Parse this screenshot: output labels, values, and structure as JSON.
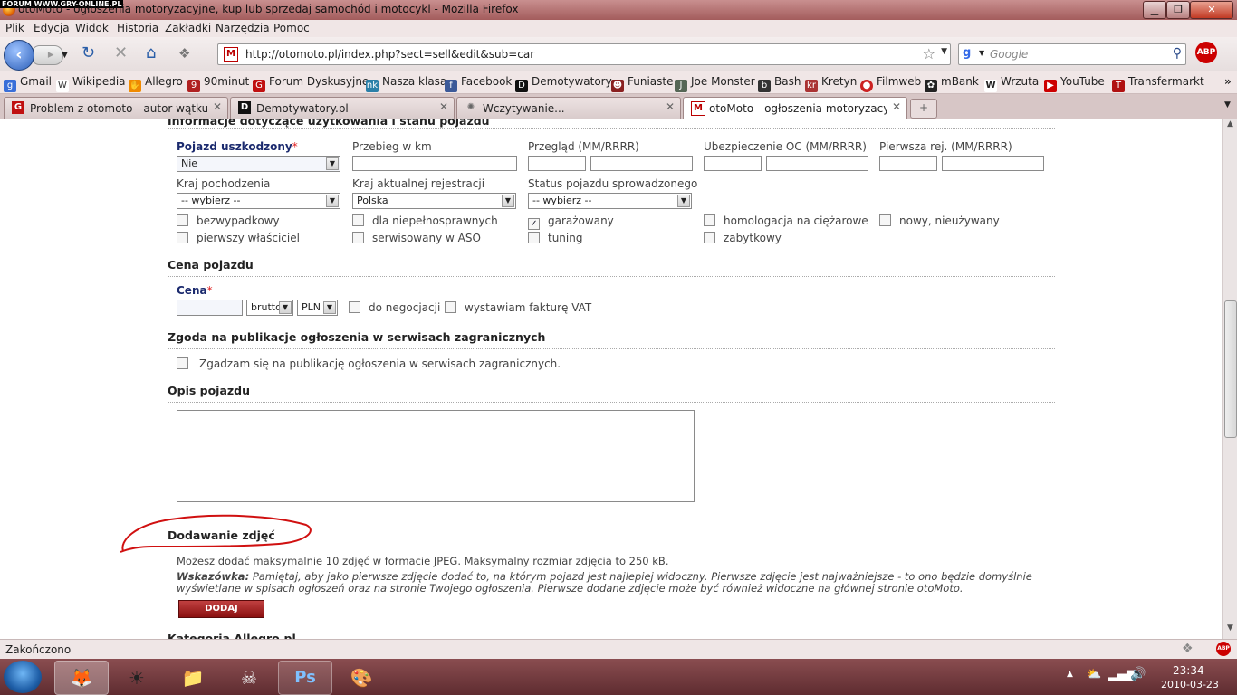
{
  "window": {
    "title": "otoMoto - ogłoszenia motoryzacyjne, kup lub sprzedaj samochód i motocykl - Mozilla Firefox",
    "watermark": "FORUM WWW.GRY-ONLINE.PL"
  },
  "menu": [
    "Plik",
    "Edycja",
    "Widok",
    "Historia",
    "Zakładki",
    "Narzędzia",
    "Pomoc"
  ],
  "nav": {
    "url": "http://otomoto.pl/index.php?sect=sell&edit&sub=car",
    "search_placeholder": "Google",
    "adblock_label": "ABP"
  },
  "bookmarks": [
    {
      "label": "Gmail",
      "icon": "gmail-icon",
      "color": "#3a6fd8"
    },
    {
      "label": "Wikipedia",
      "icon": "wikipedia-icon",
      "color": "#444444"
    },
    {
      "label": "Allegro",
      "icon": "allegro-icon",
      "color": "#f08a00"
    },
    {
      "label": "90minut",
      "icon": "90minut-icon",
      "color": "#b02020"
    },
    {
      "label": "Forum Dyskusyjne",
      "icon": "gry-online-icon",
      "color": "#c01010"
    },
    {
      "label": "Nasza klasa",
      "icon": "nasza-klasa-icon",
      "color": "#2a7fa8"
    },
    {
      "label": "Facebook",
      "icon": "facebook-icon",
      "color": "#3b5998"
    },
    {
      "label": "Demotywatory",
      "icon": "demotywatory-icon",
      "color": "#111111"
    },
    {
      "label": "Funiaste",
      "icon": "funiaste-icon",
      "color": "#8a2020"
    },
    {
      "label": "Joe Monster",
      "icon": "joe-monster-icon",
      "color": "#556655"
    },
    {
      "label": "Bash",
      "icon": "bash-icon",
      "color": "#333333"
    },
    {
      "label": "Kretyn",
      "icon": "kretyn-icon",
      "color": "#aa3333"
    },
    {
      "label": "Filmweb",
      "icon": "filmweb-icon",
      "color": "#cc2222"
    },
    {
      "label": "mBank",
      "icon": "mbank-icon",
      "color": "#222222"
    },
    {
      "label": "Wrzuta",
      "icon": "wrzuta-icon",
      "color": "#444444"
    },
    {
      "label": "YouTube",
      "icon": "youtube-icon",
      "color": "#cc0000"
    },
    {
      "label": "Transfermarkt",
      "icon": "transfermarkt-icon",
      "color": "#b01010"
    }
  ],
  "tabs": [
    {
      "label": "Problem z otomoto - autor wątku: ...",
      "icon": "G",
      "active": false
    },
    {
      "label": "Demotywatory.pl",
      "icon": "D",
      "active": false
    },
    {
      "label": "Wczytywanie...",
      "icon": "loading",
      "active": false
    },
    {
      "label": "otoMoto - ogłoszenia motoryzacy...",
      "icon": "M",
      "active": true
    }
  ],
  "form": {
    "section1_title": "Informacje dotyczące użytkowania i stanu pojazdu",
    "damaged": {
      "label": "Pojazd uszkodzony",
      "required_mark": "*",
      "value": "Nie"
    },
    "mileage_label": "Przebieg w km",
    "inspection_label": "Przegląd (MM/RRRR)",
    "insurance_label": "Ubezpieczenie OC (MM/RRRR)",
    "first_reg_label": "Pierwsza rej. (MM/RRRR)",
    "origin": {
      "label": "Kraj pochodzenia",
      "value": "-- wybierz --"
    },
    "current_reg": {
      "label": "Kraj aktualnej rejestracji",
      "value": "Polska"
    },
    "import_status": {
      "label": "Status pojazdu sprowadzonego",
      "value": "-- wybierz --"
    },
    "checkboxes": [
      {
        "label": "bezwypadkowy",
        "checked": false
      },
      {
        "label": "dla niepełnosprawnych",
        "checked": false
      },
      {
        "label": "garażowany",
        "checked": true
      },
      {
        "label": "homologacja na ciężarowe",
        "checked": false
      },
      {
        "label": "nowy, nieużywany",
        "checked": false
      },
      {
        "label": "pierwszy właściciel",
        "checked": false
      },
      {
        "label": "serwisowany w ASO",
        "checked": false
      },
      {
        "label": "tuning",
        "checked": false
      },
      {
        "label": "zabytkowy",
        "checked": false
      }
    ],
    "price_section": "Cena pojazdu",
    "price": {
      "label": "Cena",
      "required_mark": "*",
      "gross": "brutto",
      "currency": "PLN",
      "negotiable": "do negocjacji",
      "vat": "wystawiam fakturę VAT"
    },
    "foreign_section": "Zgoda na publikacje ogłoszenia w serwisach zagranicznych",
    "foreign_consent": "Zgadzam się na publikację ogłoszenia w serwisach zagranicznych.",
    "description_section": "Opis pojazdu",
    "photos_section": "Dodawanie zdjęć",
    "photos_info": "Możesz dodać maksymalnie 10 zdjęć w formacie JPEG. Maksymalny rozmiar zdjęcia to 250 kB.",
    "hint_label": "Wskazówka:",
    "hint_text": "Pamiętaj, aby jako pierwsze zdjęcie dodać to, na którym pojazd jest najlepiej widoczny. Pierwsze zdjęcie jest najważniejsze - to ono będzie domyślnie wyświetlane w spisach ogłoszeń oraz na stronie Twojego ogłoszenia. Pierwsze dodane zdjęcie może być również widoczne na głównej stronie otoMoto.",
    "add_button": "DODAJ",
    "next_section": "Kategoria Allegro.pl",
    "annotation_color": "#d01010"
  },
  "status": {
    "text": "Zakończono"
  },
  "taskbar": {
    "apps": [
      "firefox-icon",
      "sun-icon",
      "folder-icon",
      "alien-icon",
      "photoshop-icon",
      "paint-icon"
    ],
    "time": "23:34",
    "date": "2010-03-23"
  }
}
